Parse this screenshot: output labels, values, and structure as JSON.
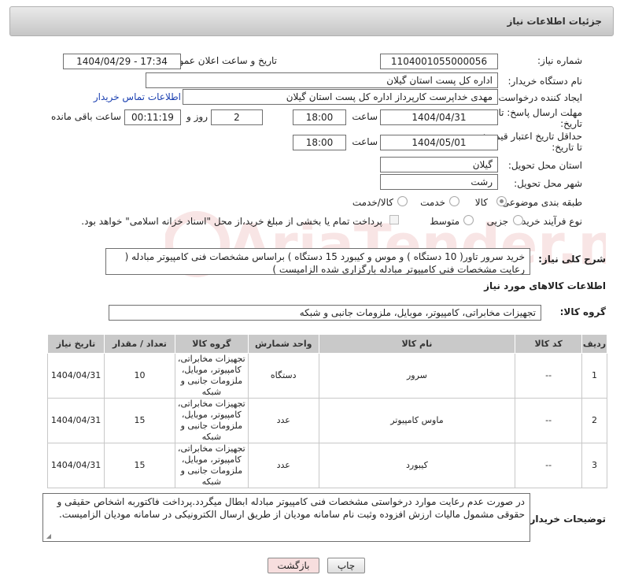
{
  "header": {
    "title": "جزئیات اطلاعات نیاز"
  },
  "fields": {
    "need_number_label": "شماره نیاز:",
    "need_number": "1104001055000056",
    "announce_label": "تاریخ و ساعت اعلان عمومی:",
    "announce_value": "1404/04/29 - 17:34",
    "buyer_org_label": "نام دستگاه خریدار:",
    "buyer_org": "اداره کل پست استان گیلان",
    "creator_label": "ایجاد کننده درخواست:",
    "creator": "مهدی  خداپرست  کارپرداز  اداره کل پست استان گیلان",
    "buyer_contact_link": "اطلاعات تماس خریدار",
    "deadline_label_1": "مهلت ارسال پاسخ: تا",
    "deadline_label_2": "تاریخ:",
    "deadline_date": "1404/04/31",
    "time_label": "ساعت",
    "deadline_time": "18:00",
    "days_value": "2",
    "days_label": "روز و",
    "remaining_time": "00:11:19",
    "remaining_label": "ساعت باقی مانده",
    "price_valid_label_1": "حداقل تاریخ اعتبار قیمت:",
    "price_valid_label_2": "تا تاریخ:",
    "price_valid_date": "1404/05/01",
    "price_valid_time": "18:00",
    "province_label": "استان محل تحویل:",
    "province": "گیلان",
    "city_label": "شهر محل تحویل:",
    "city": "رشت",
    "category_label": "طبقه بندی موضوعی:",
    "category_options": [
      "کالا",
      "خدمت",
      "کالا/خدمت"
    ],
    "process_label": "نوع فرآیند خرید :",
    "process_options": [
      "جزیی",
      "متوسط"
    ],
    "payment_note": "پرداخت تمام یا بخشی از مبلغ خرید،از محل \"اسناد خزانه اسلامی\" خواهد بود.",
    "description_label": "شرح کلی نیاز:",
    "description": "خرید سرور تاور( 10 دستگاه ) و موس و کیبورد 15 دستگاه ) براساس مشخصات فنی کامپیوتر مبادله ( رعایت مشخصات فنی کامپیوتر مبادله بارگزاری شده الزامیست )",
    "goods_info_title": "اطلاعات کالاهای مورد نیاز",
    "goods_group_label": "گروه کالا:",
    "goods_group": "تجهیزات مخابراتی، کامپیوتر، موبایل، ملزومات جانبی و شبکه"
  },
  "table": {
    "headers": [
      "ردیف",
      "کد کالا",
      "نام کالا",
      "واحد شمارش",
      "گروه کالا",
      "تعداد / مقدار",
      "تاریخ نیاز"
    ],
    "rows": [
      {
        "idx": "1",
        "code": "--",
        "name": "سرور",
        "unit": "دستگاه",
        "group": "تجهیزات مخابراتی، کامپیوتر، موبایل، ملزومات جانبی و شبکه",
        "qty": "10",
        "date": "1404/04/31"
      },
      {
        "idx": "2",
        "code": "--",
        "name": "ماوس کامپیوتر",
        "unit": "عدد",
        "group": "تجهیزات مخابراتی، کامپیوتر، موبایل، ملزومات جانبی و شبکه",
        "qty": "15",
        "date": "1404/04/31"
      },
      {
        "idx": "3",
        "code": "--",
        "name": "کیبورد",
        "unit": "عدد",
        "group": "تجهیزات مخابراتی، کامپیوتر، موبایل، ملزومات جانبی و شبکه",
        "qty": "15",
        "date": "1404/04/31"
      }
    ]
  },
  "buyer_notes_label": "توضیحات خریدار:",
  "buyer_notes": "در صورت عدم رعایت موارد درخواستی مشخصات فنی کامپیوتر مبادله ابطال میگردد.پرداخت فاکتوربه اشخاص حقیقی و حقوقی مشمول مالیات ارزش افزوده وثبت نام سامانه مودیان از طریق ارسال الکترونیکی در سامانه مودیان الزامیست.",
  "buttons": {
    "print": "چاپ",
    "back": "بازگشت"
  },
  "watermark_text": "AriaTender.neT",
  "colors": {
    "link": "#1a3fb0",
    "back_button": "#f7dede",
    "table_header": "#c9c9c9"
  }
}
